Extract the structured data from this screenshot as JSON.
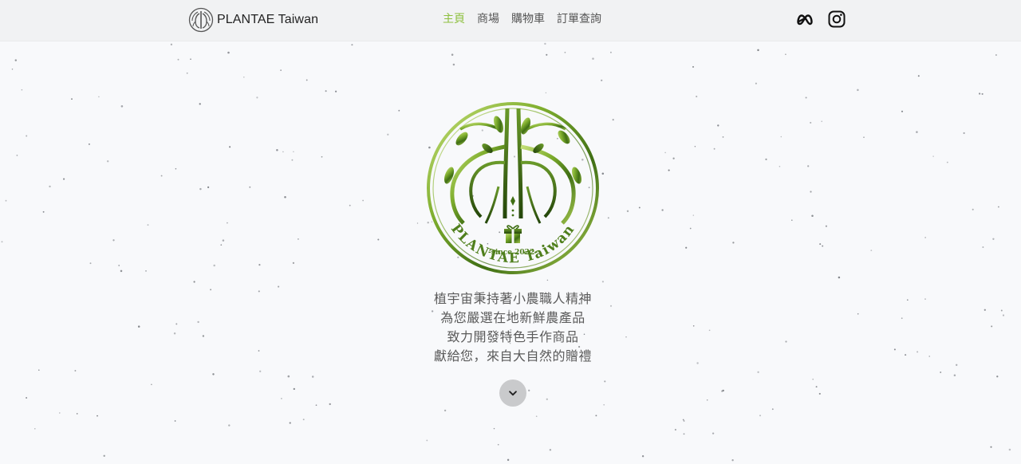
{
  "brand": {
    "name": "PLANTAE Taiwan",
    "logo_icon": "tree-roots-logo-icon"
  },
  "nav": {
    "items": [
      {
        "label": "主頁",
        "active": true
      },
      {
        "label": "商場",
        "active": false
      },
      {
        "label": "購物車",
        "active": false
      },
      {
        "label": "訂單查詢",
        "active": false
      }
    ],
    "active_color": "#8ec03f"
  },
  "social": {
    "meta_icon": "meta-icon",
    "instagram_icon": "instagram-icon"
  },
  "hero": {
    "logo_icon": "plantae-tree-emblem-icon",
    "logo_arc_text": "PLANTAE Taiwan",
    "logo_since": "-since 2022-",
    "tagline_lines": [
      "植宇宙秉持著小農職人精神",
      "為您嚴選在地新鮮農產品",
      "致力開發特色手作商品",
      "獻給您，來自大自然的贈禮"
    ],
    "scroll_icon": "chevron-down-icon"
  },
  "colors": {
    "page_bg": "#f8f9fb",
    "navbar_bg": "#f1f2f3",
    "accent_green": "#8ec03f",
    "scroll_button_bg": "#c9cacc"
  }
}
